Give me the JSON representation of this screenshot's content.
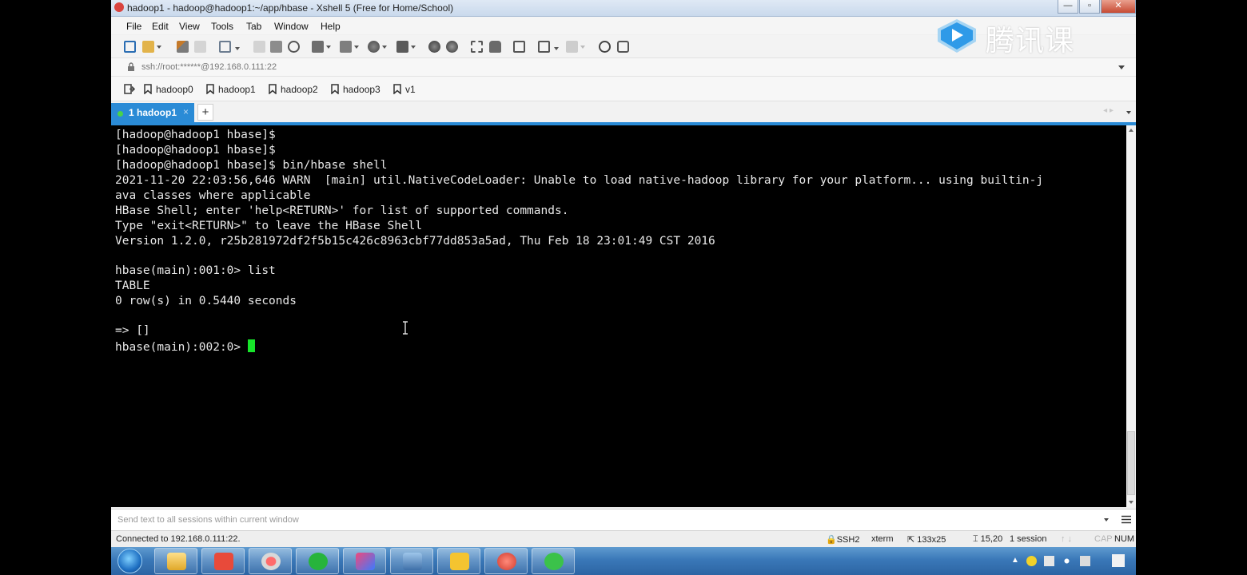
{
  "window": {
    "title": "hadoop1 - hadoop@hadoop1:~/app/hbase - Xshell 5 (Free for Home/School)",
    "controls": {
      "minimize": "—",
      "maximize": "▫",
      "close": "✕"
    }
  },
  "menu": [
    "File",
    "Edit",
    "View",
    "Tools",
    "Tab",
    "Window",
    "Help"
  ],
  "watermark": {
    "text": "腾讯课堂"
  },
  "address": {
    "value": "ssh://root:******@192.168.0.111:22"
  },
  "links": [
    "hadoop0",
    "hadoop1",
    "hadoop2",
    "hadoop3",
    "v1"
  ],
  "tabs": [
    {
      "label": "1 hadoop1",
      "active": true
    }
  ],
  "tab_close": "×",
  "tab_add": "+",
  "tab_nav": "◂ ▸",
  "terminal": {
    "lines": [
      "[hadoop@hadoop1 hbase]$",
      "[hadoop@hadoop1 hbase]$",
      "[hadoop@hadoop1 hbase]$ bin/hbase shell",
      "2021-11-20 22:03:56,646 WARN  [main] util.NativeCodeLoader: Unable to load native-hadoop library for your platform... using builtin-j",
      "ava classes where applicable",
      "HBase Shell; enter 'help<RETURN>' for list of supported commands.",
      "Type \"exit<RETURN>\" to leave the HBase Shell",
      "Version 1.2.0, r25b281972df2f5b15c426c8963cbf77dd853a5ad, Thu Feb 18 23:01:49 CST 2016",
      "",
      "hbase(main):001:0> list",
      "TABLE",
      "0 row(s) in 0.5440 seconds",
      "",
      "=> []"
    ],
    "prompt": "hbase(main):002:0> "
  },
  "compose": {
    "placeholder": "Send text to all sessions within current window"
  },
  "status": {
    "connection": "Connected to 192.168.0.111:22.",
    "protocol": "SSH2",
    "terminal_type": "xterm",
    "size": "133x25",
    "cursor_pos": "15,20",
    "sessions": "1 session",
    "arrows": "↑ ↓",
    "caps": "CAP",
    "num": "NUM"
  },
  "colors": {
    "accent": "#2a8bd6",
    "cursor": "#17e52a",
    "terminal_bg": "#000000",
    "terminal_fg": "#e8e8e8"
  }
}
